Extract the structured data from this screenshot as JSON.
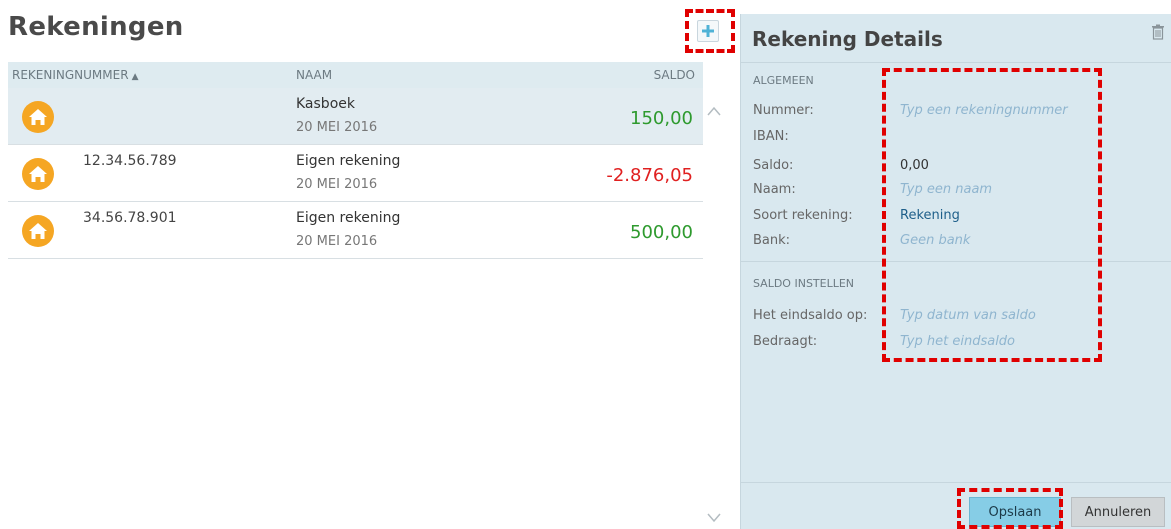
{
  "page_title": "Rekeningen",
  "table": {
    "columns": {
      "number": "REKENINGNUMMER",
      "name": "NAAM",
      "saldo": "SALDO"
    },
    "rows": [
      {
        "number": "",
        "name": "Kasboek",
        "date": "20 MEI 2016",
        "saldo": "150,00",
        "selected": true
      },
      {
        "number": "12.34.56.789",
        "name": "Eigen rekening",
        "date": "20 MEI 2016",
        "saldo": "-2.876,05"
      },
      {
        "number": "34.56.78.901",
        "name": "Eigen rekening",
        "date": "20 MEI 2016",
        "saldo": "500,00"
      }
    ]
  },
  "details": {
    "title": "Rekening Details",
    "section_general": "ALGEMEEN",
    "fields": {
      "nummer": {
        "label": "Nummer:",
        "placeholder": "Typ een rekeningnummer"
      },
      "iban": {
        "label": "IBAN:"
      },
      "saldo": {
        "label": "Saldo:",
        "value": "0,00"
      },
      "naam": {
        "label": "Naam:",
        "placeholder": "Typ een naam"
      },
      "soort": {
        "label": "Soort rekening:",
        "value": "Rekening"
      },
      "bank": {
        "label": "Bank:",
        "placeholder": "Geen bank"
      }
    },
    "section_saldo": "SALDO INSTELLEN",
    "saldo_fields": {
      "eindsaldo_op": {
        "label": "Het eindsaldo op:",
        "placeholder": "Typ datum van saldo"
      },
      "bedraagt": {
        "label": "Bedraagt:",
        "placeholder": "Typ het eindsaldo"
      }
    },
    "buttons": {
      "save": "Opslaan",
      "cancel": "Annuleren"
    }
  },
  "colors": {
    "positive": "#2e9a2e",
    "negative": "#e02020",
    "highlight": "#e00000",
    "panel_bg": "#d9e8ef",
    "save_button": "#86cde6"
  },
  "icons": [
    "plus-icon",
    "house-icon",
    "trash-icon",
    "chevron-up-icon",
    "chevron-down-icon",
    "sort-up-icon"
  ]
}
